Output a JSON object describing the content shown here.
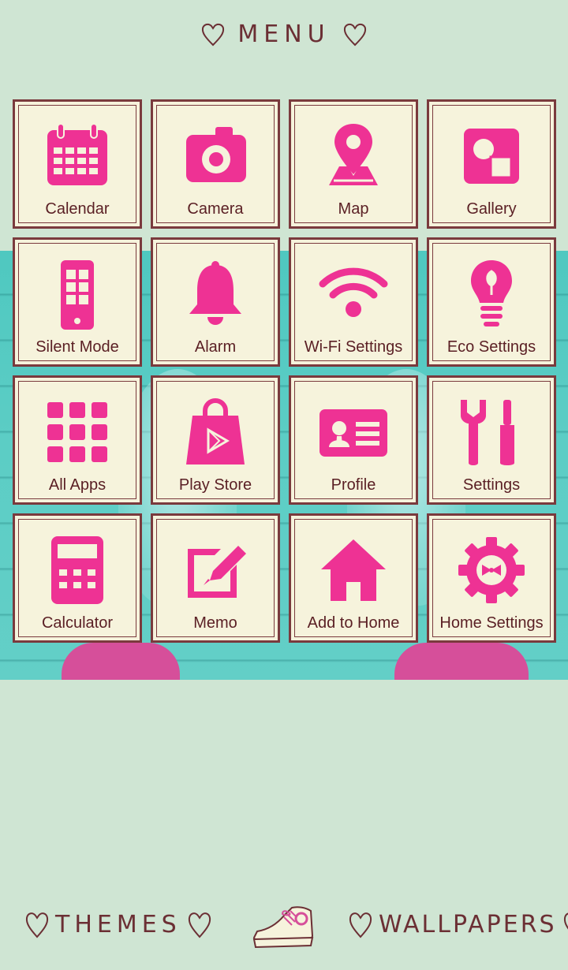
{
  "header": {
    "title": "MENU"
  },
  "menu": {
    "items": [
      {
        "label": "Calendar",
        "icon": "calendar-icon"
      },
      {
        "label": "Camera",
        "icon": "camera-icon"
      },
      {
        "label": "Map",
        "icon": "map-pin-icon"
      },
      {
        "label": "Gallery",
        "icon": "gallery-icon"
      },
      {
        "label": "Silent Mode",
        "icon": "phone-icon"
      },
      {
        "label": "Alarm",
        "icon": "bell-icon"
      },
      {
        "label": "Wi-Fi Settings",
        "icon": "wifi-icon"
      },
      {
        "label": "Eco Settings",
        "icon": "lightbulb-icon"
      },
      {
        "label": "All Apps",
        "icon": "grid-icon"
      },
      {
        "label": "Play Store",
        "icon": "shopping-bag-icon"
      },
      {
        "label": "Profile",
        "icon": "id-card-icon"
      },
      {
        "label": "Settings",
        "icon": "tools-icon"
      },
      {
        "label": "Calculator",
        "icon": "calculator-icon"
      },
      {
        "label": "Memo",
        "icon": "memo-pencil-icon"
      },
      {
        "label": "Add to Home",
        "icon": "home-icon"
      },
      {
        "label": "Home Settings",
        "icon": "gear-icon"
      }
    ]
  },
  "footer": {
    "themes_label": "THEMES",
    "wallpapers_label": "WALLPAPERS"
  },
  "colors": {
    "accent": "#ee3294",
    "frame": "#7a3a3d",
    "tile": "#f6f3dc",
    "background": "#cfe5d3"
  }
}
